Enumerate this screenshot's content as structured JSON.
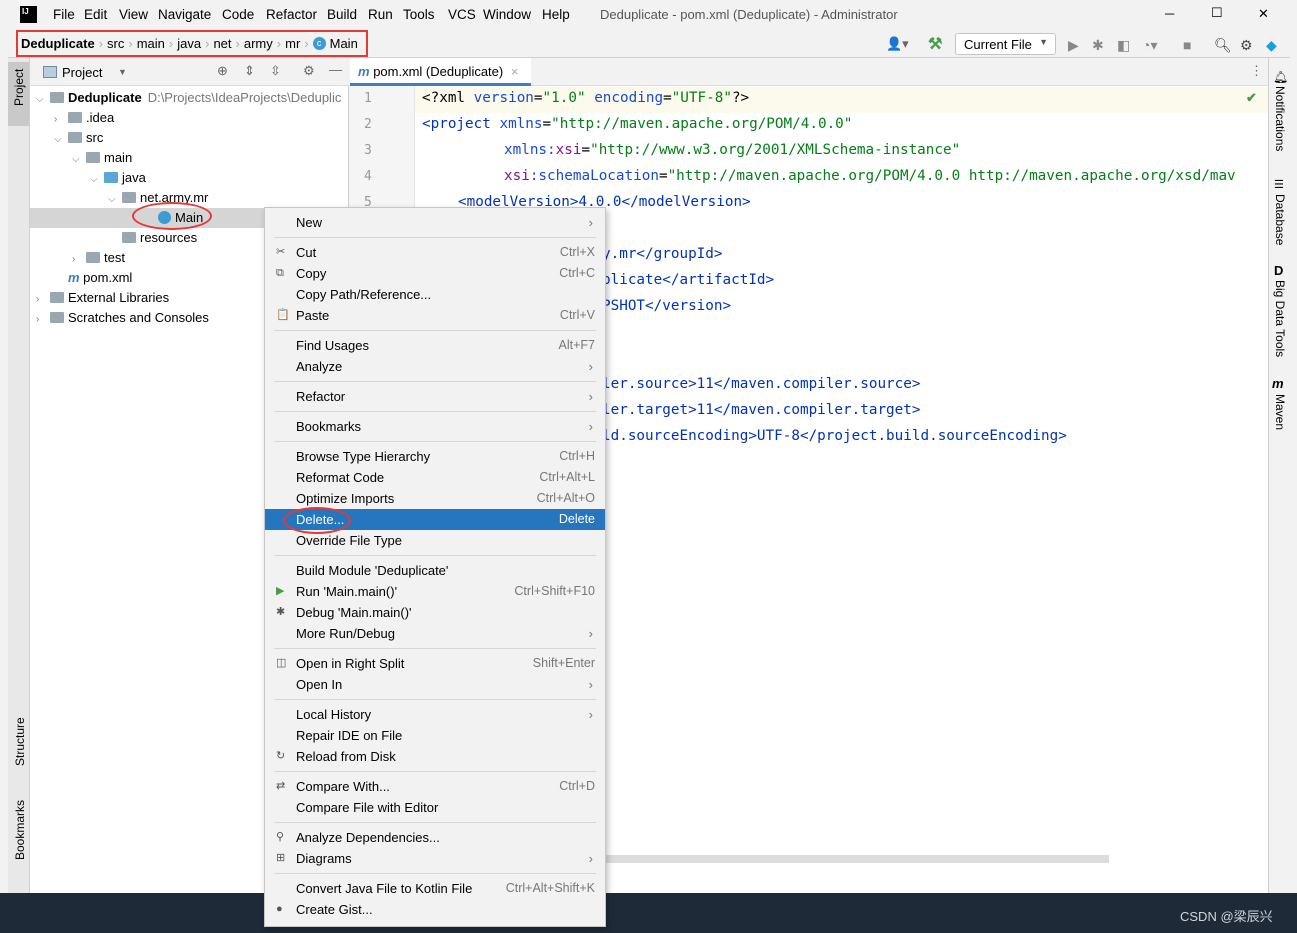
{
  "window": {
    "title": "Deduplicate - pom.xml (Deduplicate) - Administrator",
    "menu": [
      "File",
      "Edit",
      "View",
      "Navigate",
      "Code",
      "Refactor",
      "Build",
      "Run",
      "Tools",
      "VCS",
      "Window",
      "Help"
    ],
    "controls": [
      "─",
      "☐",
      "✕"
    ]
  },
  "breadcrumb": [
    "Deduplicate",
    "src",
    "main",
    "java",
    "net",
    "army",
    "mr",
    "Main"
  ],
  "toolbar": {
    "run_config": "Current File"
  },
  "project_panel": {
    "title": "Project",
    "tree": [
      {
        "label": "Deduplicate",
        "path": "D:\\Projects\\IdeaProjects\\Deduplic"
      },
      {
        "label": ".idea"
      },
      {
        "label": "src"
      },
      {
        "label": "main"
      },
      {
        "label": "java"
      },
      {
        "label": "net.army.mr"
      },
      {
        "label": "Main"
      },
      {
        "label": "resources"
      },
      {
        "label": "test"
      },
      {
        "label": "pom.xml"
      },
      {
        "label": "External Libraries"
      },
      {
        "label": "Scratches and Consoles"
      }
    ]
  },
  "left_strip": {
    "project": "Project",
    "structure": "Structure",
    "bookmarks": "Bookmarks"
  },
  "right_strip": [
    "Notifications",
    "Database",
    "Big Data Tools",
    "Maven"
  ],
  "editor": {
    "tab": "pom.xml (Deduplicate)",
    "line_numbers": [
      "1",
      "2",
      "3",
      "4",
      "5"
    ],
    "lines": {
      "l1a": "<?xml ",
      "l1b": "version",
      "l1c": "=",
      "l1d": "\"1.0\" ",
      "l1e": "encoding",
      "l1f": "=",
      "l1g": "\"UTF-8\"",
      "l1h": "?>",
      "l2a": "<project ",
      "l2b": "xmlns",
      "l2c": "=",
      "l2d": "\"http://maven.apache.org/POM/4.0.0\"",
      "l3a": "xmlns:",
      "l3b": "xsi",
      "l3c": "=",
      "l3d": "\"http://www.w3.org/2001/XMLSchema-instance\"",
      "l4a": "xsi",
      "l4b": ":schemaLocation",
      "l4c": "=",
      "l4d": "\"http://maven.apache.org/POM/4.0.0 http://maven.apache.org/xsd/mav",
      "l5": "<modelVersion>4.0.0</modelVersion>",
      "f1": "y.mr</groupId>",
      "f2": "plicate</artifactId>",
      "f3": "PSHOT</version>",
      "f4": "ler.source>11</maven.compiler.source>",
      "f5": "ler.target>11</maven.compiler.target>",
      "f6": "ld.sourceEncoding>UTF-8</project.build.sourceEncoding>"
    }
  },
  "context_menu": {
    "items": [
      {
        "label": "New",
        "sub": true
      },
      {
        "sep": true
      },
      {
        "label": "Cut",
        "shortcut": "Ctrl+X",
        "icon": "✂"
      },
      {
        "label": "Copy",
        "shortcut": "Ctrl+C",
        "icon": "⧉"
      },
      {
        "label": "Copy Path/Reference..."
      },
      {
        "label": "Paste",
        "shortcut": "Ctrl+V",
        "icon": "📋"
      },
      {
        "sep": true
      },
      {
        "label": "Find Usages",
        "shortcut": "Alt+F7"
      },
      {
        "label": "Analyze",
        "sub": true
      },
      {
        "sep": true
      },
      {
        "label": "Refactor",
        "sub": true
      },
      {
        "sep": true
      },
      {
        "label": "Bookmarks",
        "sub": true
      },
      {
        "sep": true
      },
      {
        "label": "Browse Type Hierarchy",
        "shortcut": "Ctrl+H"
      },
      {
        "label": "Reformat Code",
        "shortcut": "Ctrl+Alt+L"
      },
      {
        "label": "Optimize Imports",
        "shortcut": "Ctrl+Alt+O"
      },
      {
        "label": "Delete...",
        "shortcut": "Delete",
        "selected": true
      },
      {
        "label": "Override File Type"
      },
      {
        "sep": true
      },
      {
        "label": "Build Module 'Deduplicate'"
      },
      {
        "label": "Run 'Main.main()'",
        "shortcut": "Ctrl+Shift+F10",
        "icon": "▶"
      },
      {
        "label": "Debug 'Main.main()'",
        "icon": "✱"
      },
      {
        "label": "More Run/Debug",
        "sub": true
      },
      {
        "sep": true
      },
      {
        "label": "Open in Right Split",
        "shortcut": "Shift+Enter",
        "icon": "◫"
      },
      {
        "label": "Open In",
        "sub": true
      },
      {
        "sep": true
      },
      {
        "label": "Local History",
        "sub": true
      },
      {
        "label": "Repair IDE on File"
      },
      {
        "label": "Reload from Disk",
        "icon": "↻"
      },
      {
        "sep": true
      },
      {
        "label": "Compare With...",
        "shortcut": "Ctrl+D",
        "icon": "⇄"
      },
      {
        "label": "Compare File with Editor"
      },
      {
        "sep": true
      },
      {
        "label": "Analyze Dependencies...",
        "icon": "⚲"
      },
      {
        "label": "Diagrams",
        "sub": true,
        "icon": "⊞"
      },
      {
        "sep": true
      },
      {
        "label": "Convert Java File to Kotlin File",
        "shortcut": "Ctrl+Alt+Shift+K"
      },
      {
        "label": "Create Gist...",
        "icon": "●"
      }
    ]
  },
  "watermark": "CSDN @梁辰兴",
  "colors": {
    "accent": "#2675bf",
    "highlight": "#e53935"
  }
}
